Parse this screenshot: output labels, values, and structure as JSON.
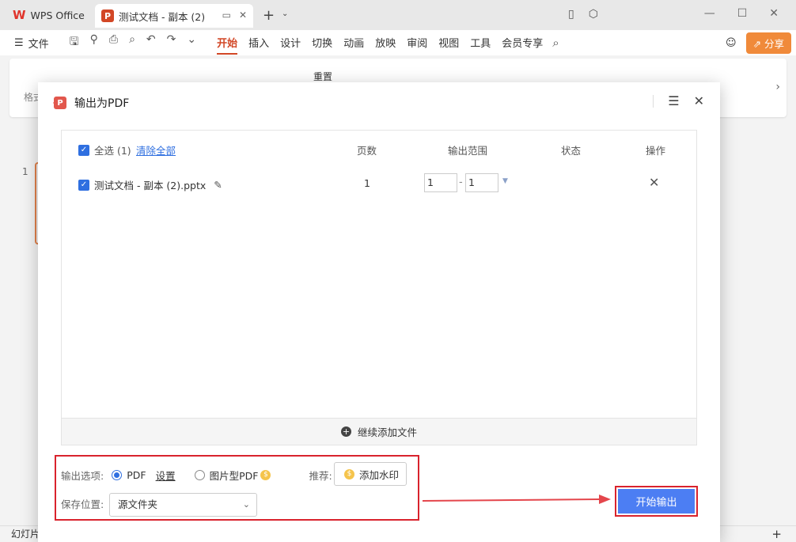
{
  "titlebar": {
    "home_tab": "WPS Office",
    "doc_tab": "测试文档 - 副本 (2)",
    "doc_badge": "P",
    "new_tab": "+",
    "icons": [
      "new-tab-icon",
      "sidebar-toggle-icon",
      "package-icon",
      "minimize-icon",
      "maximize-icon",
      "close-icon"
    ]
  },
  "menubar": {
    "file": "文件",
    "tabs": [
      "开始",
      "插入",
      "设计",
      "切换",
      "动画",
      "放映",
      "审阅",
      "视图",
      "工具",
      "会员专享"
    ],
    "active_tab": "开始",
    "share": "分享"
  },
  "ribbon": {
    "format_label": "格式",
    "reset_label": "重置"
  },
  "workspace": {
    "slide_number": "1",
    "status_text": "幻灯片"
  },
  "dialog": {
    "title": "输出为PDF",
    "header": {
      "select_all": "全选 (1)",
      "clear_all": "清除全部",
      "pages": "页数",
      "range": "输出范围",
      "status": "状态",
      "actions": "操作"
    },
    "files": [
      {
        "name": "测试文档 - 副本 (2).pptx",
        "pages": "1",
        "range_from": "1",
        "range_to": "1",
        "range_sep": "-",
        "status": ""
      }
    ],
    "add_more": "继续添加文件",
    "options": {
      "label": "输出选项:",
      "pdf": "PDF",
      "settings": "设置",
      "image_pdf": "图片型PDF",
      "recommend": "推荐:",
      "add_watermark": "添加水印",
      "save_label": "保存位置:",
      "save_value": "源文件夹"
    },
    "start_button": "开始输出"
  },
  "colors": {
    "accent": "#d24726",
    "primary_button": "#4c7ef3",
    "highlight_box": "#d9232d",
    "checkbox": "#2f6fe0"
  }
}
